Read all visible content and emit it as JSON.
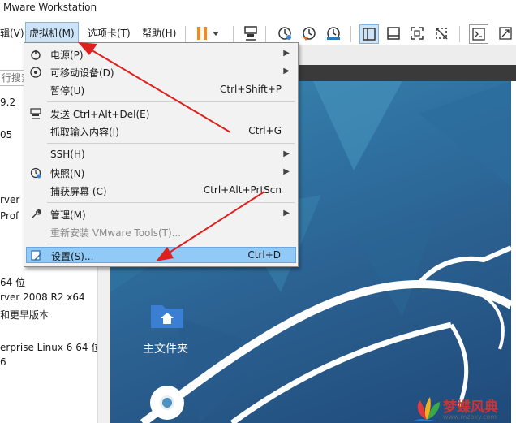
{
  "window": {
    "title": "Mware Workstation"
  },
  "menubar": {
    "items": [
      {
        "label": "辑(V)"
      },
      {
        "label": "虚拟机(M)"
      },
      {
        "label": "选项卡(T)"
      },
      {
        "label": "帮助(H)"
      }
    ]
  },
  "toolbar": {
    "icons": [
      "pause-icon",
      "dropdown-icon",
      "send-ctrl-alt-del-icon",
      "snapshot-icon",
      "revert-snapshot-icon",
      "snapshot-manager-icon",
      "library-view-icon",
      "console-view-icon",
      "fullscreen-icon",
      "unity-icon",
      "terminal-icon",
      "stretch-icon"
    ]
  },
  "library": {
    "search_placeholder": "行搜索",
    "rows": [
      "9.2",
      "05",
      "rver 2",
      "Prof",
      "64 位",
      "rver 2008 R2 x64",
      "和更早版本",
      "erprise Linux 6 64 位",
      "6"
    ]
  },
  "vm_menu": {
    "items": [
      {
        "label": "电源(P)",
        "shortcut": "",
        "submenu": true,
        "icon": "power-icon"
      },
      {
        "label": "可移动设备(D)",
        "shortcut": "",
        "submenu": true,
        "icon": "removable-device-icon"
      },
      {
        "label": "暂停(U)",
        "shortcut": "Ctrl+Shift+P",
        "submenu": false,
        "icon": ""
      },
      {
        "label": "发送 Ctrl+Alt+Del(E)",
        "shortcut": "",
        "submenu": false,
        "icon": "send-keys-icon"
      },
      {
        "label": "抓取输入内容(I)",
        "shortcut": "Ctrl+G",
        "submenu": false,
        "icon": ""
      },
      {
        "label": "SSH(H)",
        "shortcut": "",
        "submenu": true,
        "icon": ""
      },
      {
        "label": "快照(N)",
        "shortcut": "",
        "submenu": true,
        "icon": "snapshot-icon"
      },
      {
        "label": "捕获屏幕 (C)",
        "shortcut": "Ctrl+Alt+PrtScn",
        "submenu": false,
        "icon": ""
      },
      {
        "label": "管理(M)",
        "shortcut": "",
        "submenu": true,
        "icon": "wrench-icon"
      },
      {
        "label": "重新安装 VMware Tools(T)...",
        "shortcut": "",
        "submenu": false,
        "icon": ""
      },
      {
        "label": "设置(S)...",
        "shortcut": "Ctrl+D",
        "submenu": false,
        "icon": "settings-icon"
      }
    ]
  },
  "desktop": {
    "home_folder_label": "主文件夹"
  },
  "watermark": {
    "text": "梦蝶风典",
    "url": "www.mzbky.com"
  },
  "colors": {
    "accent": "#91c9f7",
    "arrow": "#e0201c"
  }
}
